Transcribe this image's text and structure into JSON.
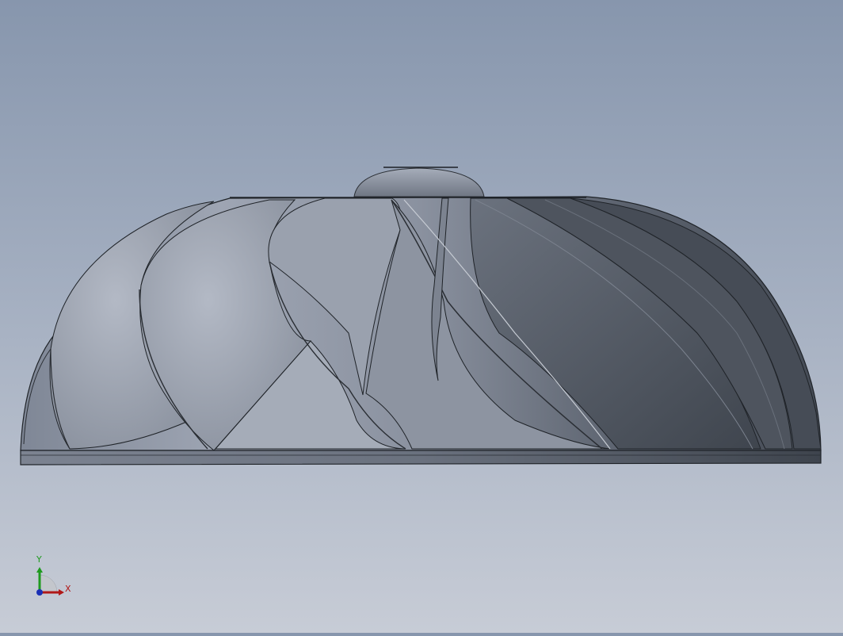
{
  "viewport": {
    "model": "impeller",
    "background_top": "#8796ad",
    "background_bottom": "#c7ccd6"
  },
  "triad": {
    "x_label": "X",
    "y_label": "Y",
    "x_color": "#b01818",
    "y_color": "#1f9a1f",
    "z_color": "#1a2fb5"
  }
}
